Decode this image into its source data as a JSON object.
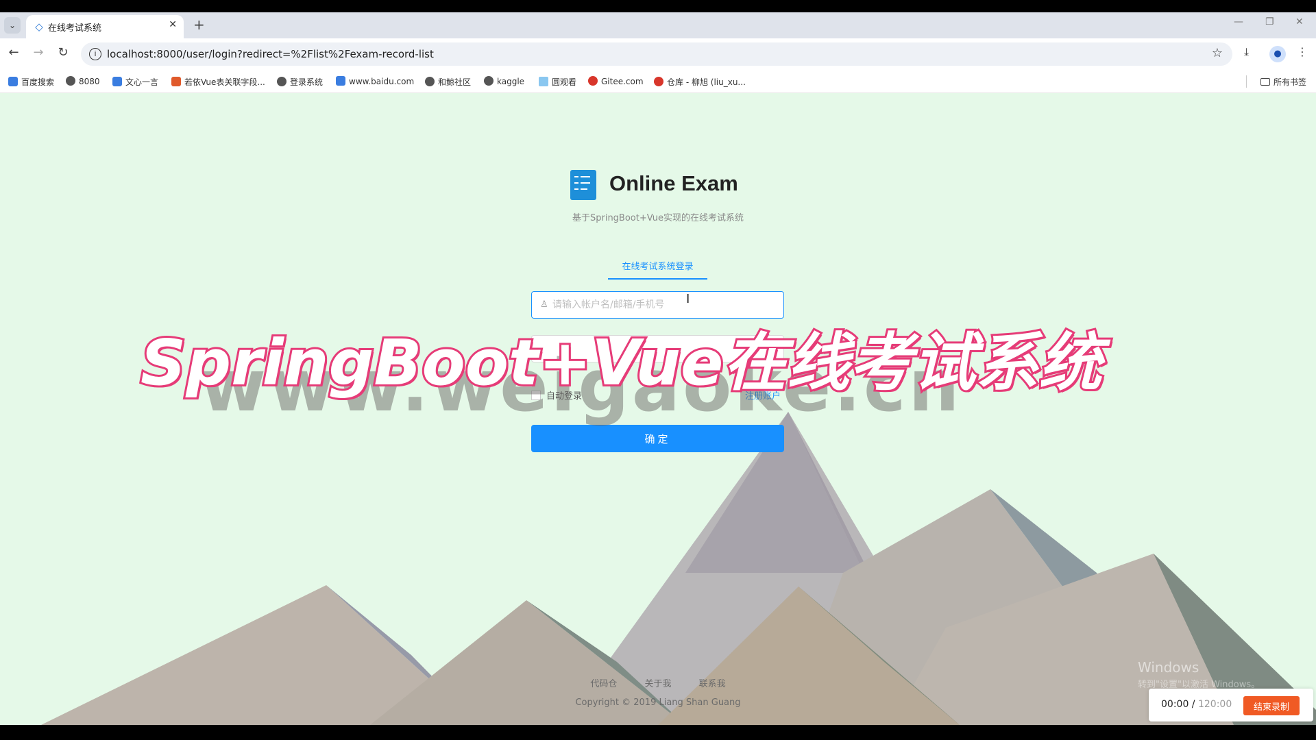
{
  "browser": {
    "tab_title": "在线考试系统",
    "new_tab": "+",
    "url": "localhost:8000/user/login?redirect=%2Flist%2Fexam-record-list",
    "bookmarks": [
      {
        "label": "百度搜索"
      },
      {
        "label": "8080"
      },
      {
        "label": "文心一言"
      },
      {
        "label": "若依Vue表关联字段..."
      },
      {
        "label": "登录系统"
      },
      {
        "label": "www.baidu.com"
      },
      {
        "label": "和鲸社区"
      },
      {
        "label": "kaggle"
      },
      {
        "label": "圆观看"
      },
      {
        "label": "Gitee.com"
      },
      {
        "label": "仓库 - 柳旭 (liu_xu..."
      }
    ],
    "all_bookmarks": "所有书签"
  },
  "login": {
    "brand": "Online Exam",
    "subtitle": "基于SpringBoot+Vue实现的在线考试系统",
    "tab_label": "在线考试系统登录",
    "username_placeholder": "请输入帐户名/邮箱/手机号",
    "remember_label": "自动登录",
    "register_label": "注册账户",
    "submit_label": "确定"
  },
  "footer": {
    "links": [
      "代码仓",
      "关于我",
      "联系我"
    ],
    "copyright": "Copyright © 2019 Liang Shan Guang"
  },
  "overlay": {
    "banner": "SpringBoot+Vue在线考试系统",
    "watermark": "www.weigaoke.cn",
    "windows_watermark_1": "Windows",
    "windows_watermark_2": "转到\"设置\"以激活 Windows。"
  },
  "recorder": {
    "elapsed": "00:00",
    "total": "120:00",
    "stop_label": "结束录制"
  },
  "colors": {
    "primary": "#1890ff",
    "page_bg": "#e5f9e8",
    "banner_pink": "#e63c78",
    "stop_orange": "#f05a24"
  }
}
